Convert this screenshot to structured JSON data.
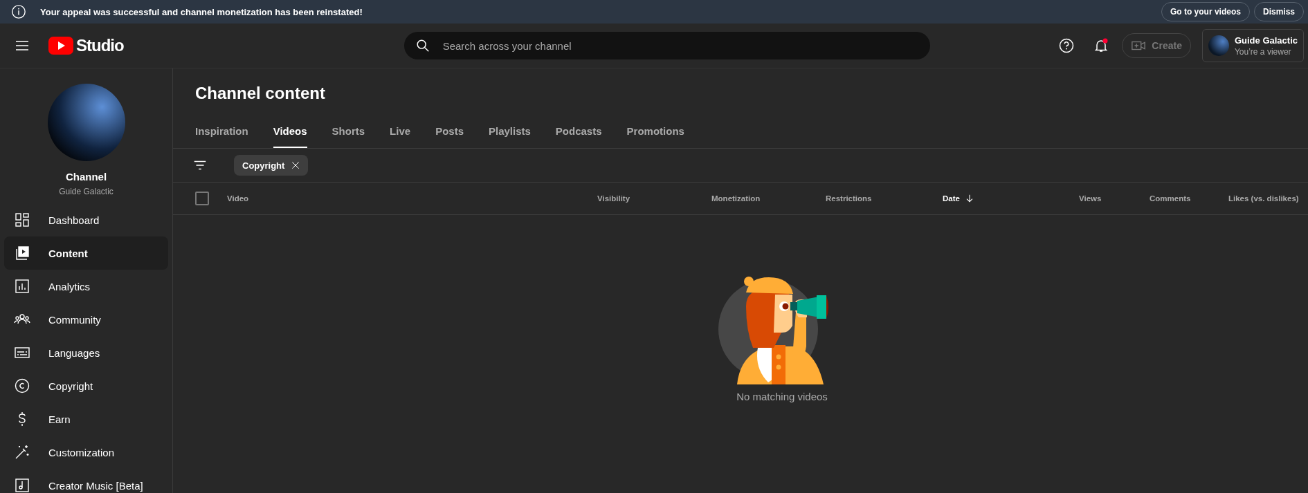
{
  "banner": {
    "message": "Your appeal was successful and channel monetization has been reinstated!",
    "buttons": [
      "Go to your videos",
      "Dismiss"
    ]
  },
  "header": {
    "logo": "Studio",
    "search": {
      "placeholder": "Search across your channel"
    },
    "notifications_unread": true,
    "create": {
      "label": "Create",
      "disabled": true
    },
    "account": {
      "name": "Guide Galactic",
      "role": "You’re a viewer"
    }
  },
  "sidebar": {
    "channel_label": "Channel",
    "channel_name": "Guide Galactic",
    "items": [
      {
        "label": "Dashboard",
        "kind": "dashboard",
        "selected": false
      },
      {
        "label": "Content",
        "kind": "content",
        "selected": true
      },
      {
        "label": "Analytics",
        "kind": "analytics",
        "selected": false
      },
      {
        "label": "Community",
        "kind": "community",
        "selected": false
      },
      {
        "label": "Languages",
        "kind": "languages",
        "selected": false
      },
      {
        "label": "Copyright",
        "kind": "copyright",
        "selected": false
      },
      {
        "label": "Earn",
        "kind": "earn",
        "selected": false
      },
      {
        "label": "Customization",
        "kind": "customization",
        "selected": false
      },
      {
        "label": "Creator Music [Beta]",
        "kind": "music",
        "selected": false
      }
    ]
  },
  "main": {
    "title": "Channel content",
    "tabs": [
      {
        "label": "Inspiration",
        "selected": false
      },
      {
        "label": "Videos",
        "selected": true
      },
      {
        "label": "Shorts",
        "selected": false
      },
      {
        "label": "Live",
        "selected": false
      },
      {
        "label": "Posts",
        "selected": false
      },
      {
        "label": "Playlists",
        "selected": false
      },
      {
        "label": "Podcasts",
        "selected": false
      },
      {
        "label": "Promotions",
        "selected": false
      }
    ],
    "filters": [
      {
        "label": "Copyright"
      }
    ],
    "table": {
      "select_all_checked": false,
      "columns": [
        {
          "label": "Video",
          "sorted": false
        },
        {
          "label": "Visibility",
          "sorted": false
        },
        {
          "label": "Monetization",
          "sorted": false
        },
        {
          "label": "Restrictions",
          "sorted": false
        },
        {
          "label": "Date",
          "sorted": true
        },
        {
          "label": "Views",
          "sorted": false
        },
        {
          "label": "Comments",
          "sorted": false
        },
        {
          "label": "Likes (vs. dislikes)",
          "sorted": false
        }
      ]
    },
    "empty_message": "No matching videos"
  }
}
